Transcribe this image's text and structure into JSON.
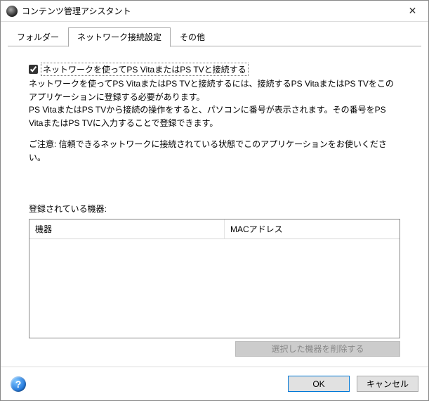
{
  "window": {
    "title": "コンテンツ管理アシスタント"
  },
  "tabs": {
    "folder": "フォルダー",
    "network": "ネットワーク接続設定",
    "other": "その他"
  },
  "network_tab": {
    "checkbox_label": "ネットワークを使ってPS VitaまたはPS TVと接続する",
    "checkbox_checked": true,
    "desc_line1": "ネットワークを使ってPS VitaまたはPS TVと接続するには、接続するPS VitaまたはPS TVをこのアプリケーションに登録する必要があります。",
    "desc_line2": "PS VitaまたはPS TVから接続の操作をすると、パソコンに番号が表示されます。その番号をPS VitaまたはPS TVに入力することで登録できます。",
    "notice": "ご注意: 信頼できるネットワークに接続されている状態でこのアプリケーションをお使いください。",
    "registered_label": "登録されている機器:",
    "col_device": "機器",
    "col_mac": "MACアドレス",
    "delete_button": "選択した機器を削除する"
  },
  "footer": {
    "ok": "OK",
    "cancel": "キャンセル",
    "help_glyph": "?"
  },
  "close_glyph": "✕"
}
